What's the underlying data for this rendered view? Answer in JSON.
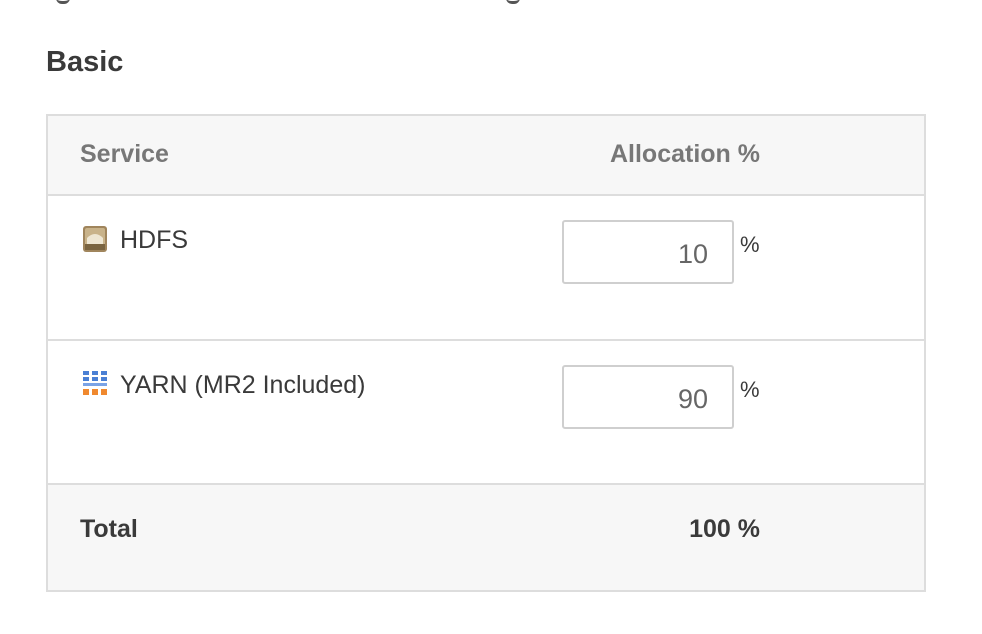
{
  "section": {
    "title": "Basic"
  },
  "table": {
    "headers": {
      "service": "Service",
      "allocation": "Allocation %"
    },
    "rows": [
      {
        "icon": "hdfs-icon",
        "service": "HDFS",
        "value": "10",
        "unit": "%"
      },
      {
        "icon": "yarn-icon",
        "service": "YARN (MR2 Included)",
        "value": "90",
        "unit": "%"
      }
    ],
    "footer": {
      "label": "Total",
      "value": "100 %"
    }
  },
  "colors": {
    "header_bg": "#f7f7f7",
    "border": "#dddddd",
    "header_text": "#777777",
    "body_text": "#3a3a3a"
  }
}
